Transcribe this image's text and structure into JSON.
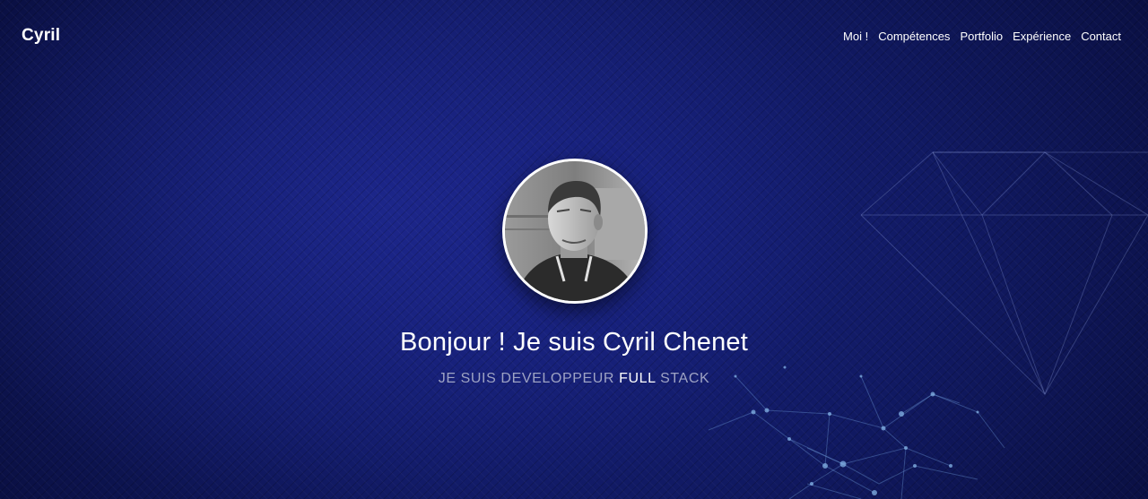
{
  "header": {
    "brand": "Cyril",
    "nav": [
      {
        "label": "Moi !"
      },
      {
        "label": "Compétences"
      },
      {
        "label": "Portfolio"
      },
      {
        "label": "Expérience"
      },
      {
        "label": "Contact"
      }
    ]
  },
  "hero": {
    "title": "Bonjour ! Je suis Cyril Chenet",
    "subtitle_part1": "JE SUIS DEVELOPPEUR ",
    "subtitle_part2": "FULL",
    "subtitle_part3": " S",
    "subtitle_part4": "TACK"
  },
  "colors": {
    "background": "#111a64",
    "text": "#ffffff",
    "subtitle": "#9ea3c4"
  }
}
